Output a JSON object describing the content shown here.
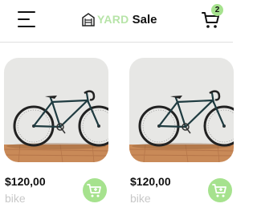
{
  "header": {
    "menu_icon": "hamburger-menu-icon",
    "logo": {
      "part1": "YARD",
      "part2": "Sale"
    },
    "cart": {
      "icon": "shopping-cart-icon",
      "count": "2"
    }
  },
  "colors": {
    "accent": "#a6e28e",
    "logo_light": "#b7e4a8",
    "text": "#111111",
    "muted": "#c8c8c8"
  },
  "products": [
    {
      "price": "$120,00",
      "name": "bike",
      "image": "bicycle-photo",
      "action_icon": "add-to-cart-icon"
    },
    {
      "price": "$120,00",
      "name": "bike",
      "image": "bicycle-photo",
      "action_icon": "add-to-cart-icon"
    }
  ]
}
